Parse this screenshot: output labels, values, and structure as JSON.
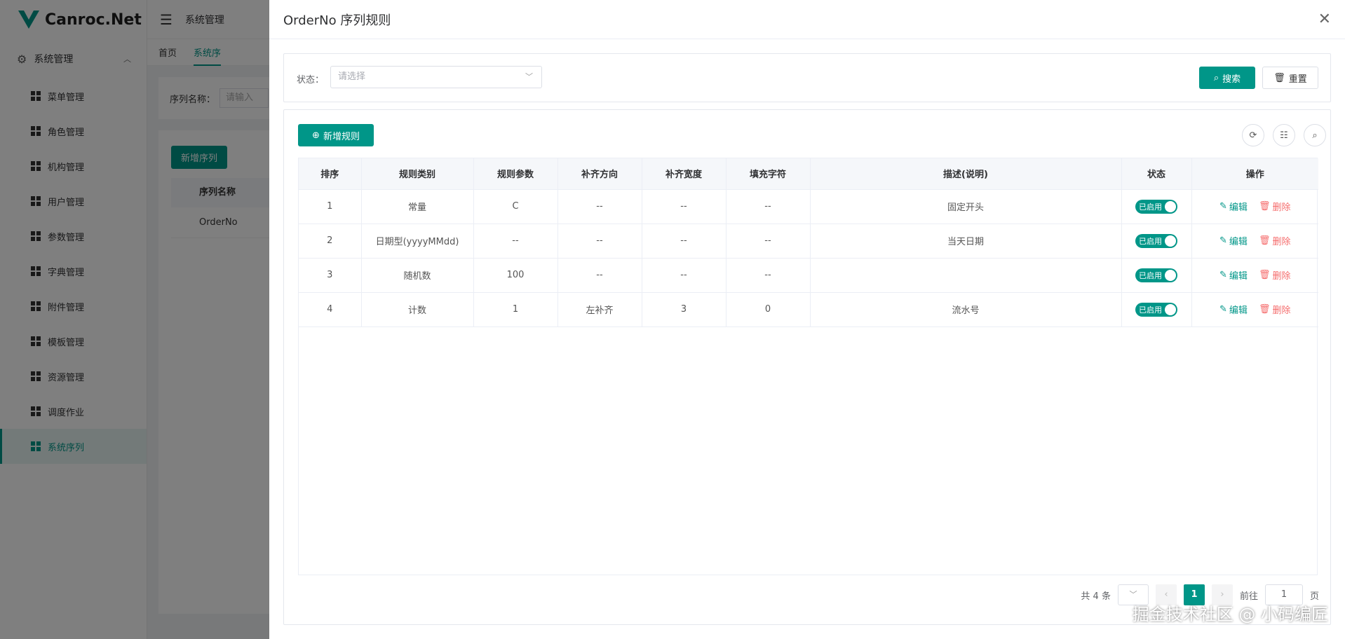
{
  "app": {
    "logo_text": "Canroc.Net",
    "menu_group": "系统管理",
    "menu_items": [
      "菜单管理",
      "角色管理",
      "机构管理",
      "用户管理",
      "参数管理",
      "字典管理",
      "附件管理",
      "模板管理",
      "资源管理",
      "调度作业",
      "系统序列"
    ],
    "active_menu": "系统序列",
    "breadcrumb": "系统管理",
    "tabs": [
      "首页",
      "系统序"
    ],
    "bg_search_label": "序列名称：",
    "bg_search_placeholder": "请输入",
    "bg_add_button": "新增序列",
    "bg_table_header": "序列名称",
    "bg_table_row": "OrderNo"
  },
  "drawer": {
    "title": "OrderNo 序列规则",
    "close_icon": "close-icon",
    "filter": {
      "status_label": "状态：",
      "status_placeholder": "请选择",
      "search_button": "搜索",
      "reset_button": "重置"
    },
    "add_rule_button": "新增规则",
    "table": {
      "columns": [
        "排序",
        "规则类别",
        "规则参数",
        "补齐方向",
        "补齐宽度",
        "填充字符",
        "描述(说明)",
        "状态",
        "操作"
      ],
      "rows": [
        {
          "order": "1",
          "category": "常量",
          "param": "C",
          "direction": "--",
          "width": "--",
          "fill": "--",
          "desc": "固定开头",
          "status": "已启用"
        },
        {
          "order": "2",
          "category": "日期型(yyyyMMdd)",
          "param": "--",
          "direction": "--",
          "width": "--",
          "fill": "--",
          "desc": "当天日期",
          "status": "已启用"
        },
        {
          "order": "3",
          "category": "随机数",
          "param": "100",
          "direction": "--",
          "width": "--",
          "fill": "--",
          "desc": "",
          "status": "已启用"
        },
        {
          "order": "4",
          "category": "计数",
          "param": "1",
          "direction": "左补齐",
          "width": "3",
          "fill": "0",
          "desc": "流水号",
          "status": "已启用"
        }
      ],
      "edit_label": "编辑",
      "delete_label": "删除"
    },
    "pagination": {
      "total": "共 4 条",
      "current_page": "1",
      "goto_label": "前往",
      "goto_value": "1",
      "page_suffix": "页"
    }
  },
  "watermark": "掘金技术社区 @ 小码编匠",
  "colors": {
    "accent": "#009688",
    "danger": "#f56c6c"
  }
}
